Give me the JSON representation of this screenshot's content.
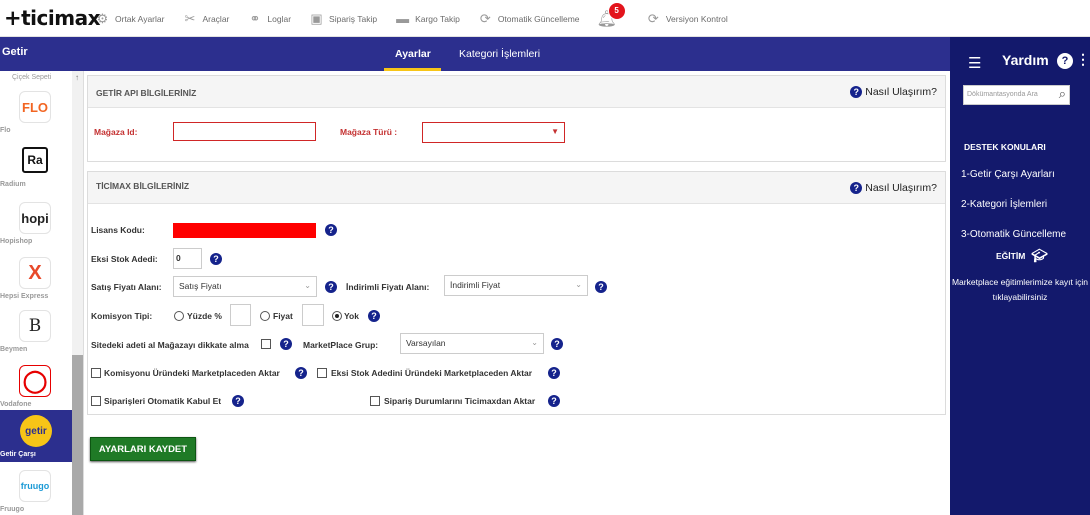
{
  "app": {
    "logo": "ticimax"
  },
  "topnav": [
    {
      "label": "Ortak Ayarlar",
      "icon": "gear-icon"
    },
    {
      "label": "Araçlar",
      "icon": "tools-icon"
    },
    {
      "label": "Loglar",
      "icon": "logs-icon"
    },
    {
      "label": "Sipariş Takip",
      "icon": "box-icon"
    },
    {
      "label": "Kargo Takip",
      "icon": "truck-icon"
    },
    {
      "label": "Otomatik Güncelleme",
      "icon": "sync-icon"
    }
  ],
  "notifications": {
    "count": "5",
    "icon": "bell-icon"
  },
  "version_control": {
    "label": "Versiyon Kontrol",
    "icon": "sync-icon"
  },
  "subbar": {
    "store": "Getir",
    "tabs": [
      "Ayarlar",
      "Kategori İşlemleri"
    ],
    "active_tab": "Ayarlar"
  },
  "sidebar": {
    "top_item": "Çiçek Sepeti",
    "items": [
      {
        "label": "Flo",
        "logo": "FLO",
        "color": "#f26522"
      },
      {
        "label": "Radium",
        "logo": "Ra",
        "color": "#111111"
      },
      {
        "label": "Hopishop",
        "logo": "hopi",
        "color": "#222222"
      },
      {
        "label": "Hepsi Express",
        "logo": "X",
        "color": "#e8492a"
      },
      {
        "label": "Beymen",
        "logo": "B",
        "color": "#222222"
      },
      {
        "label": "Vodafone",
        "logo": "◯",
        "color": "#e60000"
      },
      {
        "label": "Getir Çarşı",
        "logo": "getir",
        "color": "#f7c517"
      },
      {
        "label": "Fruugo",
        "logo": "fruugo",
        "color": "#1b9ad6"
      }
    ],
    "active": "Getir Çarşı"
  },
  "api_section": {
    "title": "GETİR API BİLGİLERİNİZ",
    "help": "Nasıl Ulaşırım?",
    "store_id_label": "Mağaza Id:",
    "store_id_value": "",
    "store_type_label": "Mağaza Türü :",
    "store_type_value": ""
  },
  "ticimax_section": {
    "title": "TİCİMAX BİLGİLERİNİZ",
    "help": "Nasıl Ulaşırım?",
    "license_label": "Lisans Kodu:",
    "minus_stock_label": "Eksi Stok Adedi:",
    "minus_stock_value": "0",
    "sale_price_label": "Satış Fiyatı Alanı:",
    "sale_price_value": "Satış Fiyatı",
    "discount_price_label": "İndirimli Fiyatı Alanı:",
    "discount_price_value": "İndirimli Fiyat",
    "commission_label": "Komisyon Tipi:",
    "commission_options": [
      "Yüzde %",
      "Fiyat",
      "Yok"
    ],
    "commission_selected": "Yok",
    "site_stock_label": "Sitedeki adeti al Mağazayı dikkate alma",
    "mp_group_label": "MarketPlace Grup:",
    "mp_group_value": "Varsayılan",
    "commission_transfer_label": "Komisyonu Üründeki Marketplaceden Aktar",
    "minus_stock_transfer_label": "Eksi Stok Adedini Üründeki Marketplaceden Aktar",
    "auto_accept_label": "Siparişleri Otomatik Kabul Et",
    "order_status_label": "Sipariş Durumlarını Ticimaxdan Aktar"
  },
  "save_button": "AYARLARI KAYDET",
  "help_panel": {
    "title": "Yardım",
    "search_placeholder": "Dökümantasyonda Ara",
    "topics_title": "DESTEK KONULARI",
    "topics": [
      "1-Getir Çarşı Ayarları",
      "2-Kategori İşlemleri",
      "3-Otomatik Güncelleme"
    ],
    "education_label": "EĞİTİM",
    "education_note": "Marketplace eğitimlerimize kayıt için tıklayabilirsiniz"
  }
}
